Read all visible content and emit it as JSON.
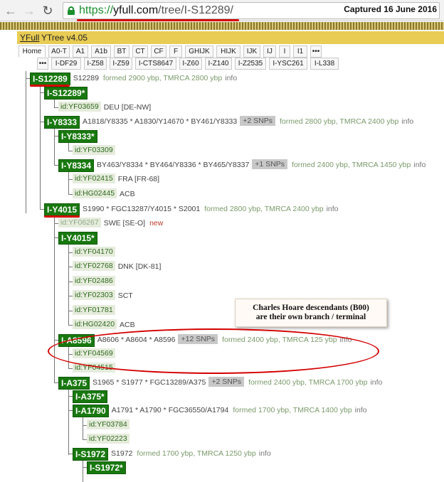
{
  "browser": {
    "url_scheme": "https://",
    "url_host": "yfull.com",
    "url_path": "/tree/I-S12289/",
    "captured_label": "Captured 16 June 2016"
  },
  "site": {
    "brand": "YFull",
    "version": "YTree v4.05"
  },
  "tabs_row1": [
    "Home",
    "A0-T",
    "A1",
    "A1b",
    "BT",
    "CT",
    "CF",
    "F",
    "GHIJK",
    "HIJK",
    "IJK",
    "IJ",
    "I",
    "I1",
    "•••"
  ],
  "tabs_row2": [
    "•••",
    "I-DF29",
    "I-Z58",
    "I-Z59",
    "I-CTS8647",
    "I-Z60",
    "I-Z140",
    "I-Z2535",
    "I-YSC261",
    "I-L338"
  ],
  "tree": {
    "root": {
      "hg": "I-S12289",
      "snps": "S12289",
      "formed": "formed 2900 ybp, TMRCA 2800 ybp",
      "info": "info"
    },
    "r_star": {
      "hg": "I-S12289*"
    },
    "r_star_id": {
      "id": "id:YF03659",
      "cc": "DEU [DE-NW]"
    },
    "y8333": {
      "hg": "I-Y8333",
      "snps": "A1818/Y8335 * A1830/Y14670 * BY461/Y8333",
      "more": "+2 SNPs",
      "formed": "formed 2800 ybp, TMRCA 2400 ybp",
      "info": "info"
    },
    "y8333_star": {
      "hg": "I-Y8333*"
    },
    "y8333_star_id": {
      "id": "id:YF03309"
    },
    "y8334": {
      "hg": "I-Y8334",
      "snps": "BY463/Y8334 * BY464/Y8336 * BY465/Y8337",
      "more": "+1 SNPs",
      "formed": "formed 2400 ybp, TMRCA 1450 ybp",
      "info": "info"
    },
    "y8334_id1": {
      "id": "id:YF02415",
      "cc": "FRA [FR-68]"
    },
    "y8334_id2": {
      "id": "id:HG02445",
      "cc": "ACB"
    },
    "y4015": {
      "hg": "I-Y4015",
      "snps": "S1990 * FGC13287/Y4015 * S2001",
      "formed": "formed 2800 ybp, TMRCA 2400 ybp",
      "info": "info"
    },
    "y4015_pale": {
      "id": "id:YF06267",
      "cc": "SWE [SE-O]",
      "new": "new"
    },
    "y4015_star": {
      "hg": "I-Y4015*"
    },
    "y4015_ids": [
      {
        "id": "id:YF04170",
        "cc": ""
      },
      {
        "id": "id:YF02768",
        "cc": "DNK [DK-81]"
      },
      {
        "id": "id:YF02486",
        "cc": ""
      },
      {
        "id": "id:YF02303",
        "cc": "SCT"
      },
      {
        "id": "id:YF01781",
        "cc": ""
      },
      {
        "id": "id:HG02420",
        "cc": "ACB"
      }
    ],
    "a8596": {
      "hg": "I-A8596",
      "snps": "A8606 * A8604 * A8596",
      "more": "+12 SNPs",
      "formed": "formed 2400 ybp, TMRCA 125 ybp",
      "info": "info"
    },
    "a8596_ids": [
      {
        "id": "id:YF04569"
      },
      {
        "id": "id:YF04515"
      }
    ],
    "a375": {
      "hg": "I-A375",
      "snps": "S1965 * S1977 * FGC13289/A375",
      "more": "+2 SNPs",
      "formed": "formed 2400 ybp, TMRCA 1700 ybp",
      "info": "info"
    },
    "a375_star": {
      "hg": "I-A375*"
    },
    "a1790": {
      "hg": "I-A1790",
      "snps": "A1791 * A1790 * FGC36550/A1794",
      "formed": "formed 1700 ybp, TMRCA 1400 ybp",
      "info": "info"
    },
    "a1790_ids": [
      {
        "id": "id:YF03784"
      },
      {
        "id": "id:YF02223"
      }
    ],
    "s1972": {
      "hg": "I-S1972",
      "snps": "S1972",
      "formed": "formed 1700 ybp, TMRCA 1250 ybp",
      "info": "info"
    },
    "s1972_star": {
      "hg": "I-S1972*"
    }
  },
  "annotation": {
    "line1": "Charles Hoare descendants (B00)",
    "line2": "are their own branch / terminal"
  },
  "colors": {
    "haplogroup_green": "#18780f",
    "annotation_red": "#d40000",
    "header_gold": "#e8cc54"
  }
}
